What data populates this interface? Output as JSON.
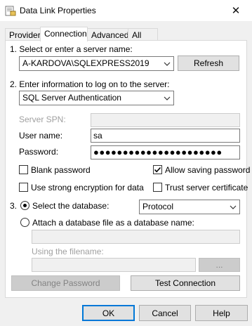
{
  "window": {
    "title": "Data Link Properties",
    "title_icon": "data-link-icon",
    "close_glyph": "✕"
  },
  "tabs": [
    {
      "label": "Provider",
      "active": false
    },
    {
      "label": "Connection",
      "active": true
    },
    {
      "label": "Advanced",
      "active": false
    },
    {
      "label": "All",
      "active": false
    }
  ],
  "section1": {
    "label": "1. Select or enter a server name:",
    "server_value": "A-KARDOVA\\SQLEXPRESS2019",
    "refresh_label": "Refresh"
  },
  "section2": {
    "label": "2. Enter information to log on to the server:",
    "auth_value": "SQL Server Authentication",
    "spn_label": "Server SPN:",
    "spn_value": "",
    "username_label": "User name:",
    "username_value": "sa",
    "password_label": "Password:",
    "password_value": "●●●●●●●●●●●●●●●●●●●●●●",
    "blank_password_label": "Blank password",
    "blank_password_checked": false,
    "allow_saving_label": "Allow saving password",
    "allow_saving_checked": true,
    "strong_encryption_label": "Use strong encryption for data",
    "strong_encryption_checked": false,
    "trust_cert_label": "Trust server certificate",
    "trust_cert_checked": false
  },
  "section3": {
    "number": "3.",
    "select_db_label": "Select the database:",
    "select_db_selected": true,
    "database_value": "Protocol",
    "attach_label": "Attach a database file as a database name:",
    "attach_selected": false,
    "attach_value": "",
    "filename_label": "Using the filename:",
    "filename_value": "",
    "browse_label": "..."
  },
  "panel_buttons": {
    "change_password": "Change Password",
    "test_connection": "Test Connection"
  },
  "dialog_buttons": {
    "ok": "OK",
    "cancel": "Cancel",
    "help": "Help"
  },
  "colors": {
    "accent_blue": "#0078d7",
    "dialog_bg": "#f0f0f0",
    "panel_bg": "#ffffff"
  }
}
